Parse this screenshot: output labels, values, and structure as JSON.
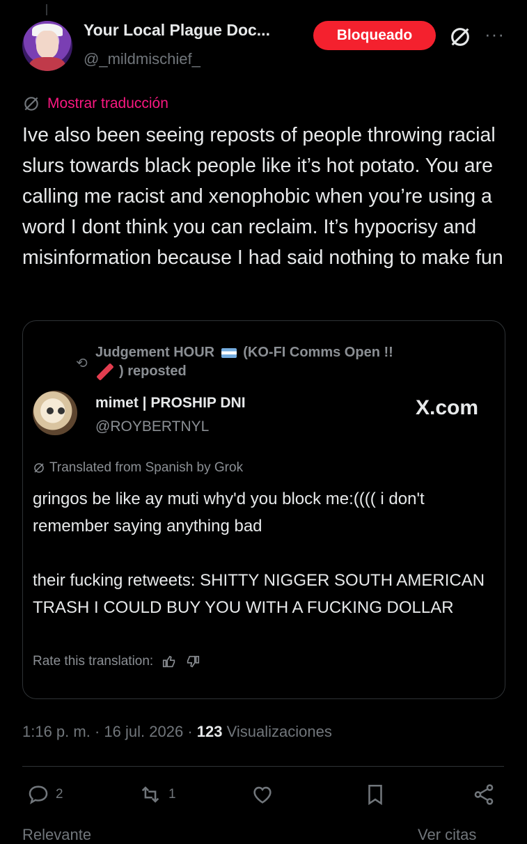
{
  "author": {
    "display_name": "Your Local Plague Doc...",
    "handle": "@_mildmischief_"
  },
  "blocked_button": {
    "label": "Bloqueado"
  },
  "translate_link": "Mostrar traducción",
  "tweet_text": "Ive also been seeing reposts of people throwing racial slurs towards black people like it’s hot potato. You are calling me racist and xenophobic when you’re using a word I dont think you can reclaim. It’s hypocrisy and misinformation because I had said nothing to make fun",
  "quote": {
    "repost_name": "Judgement HOUR",
    "repost_rest": "(KO-FI Comms Open !!",
    "repost_suffix": ") reposted",
    "name": "mimet | PROSHIP DNI",
    "handle": "@ROYBERTNYL",
    "source_label": "X.com",
    "grok_note": "Translated from Spanish by Grok",
    "text": "gringos be like ay muti why'd you block me:(((( i don't remember saying anything bad\n\ntheir fucking retweets: SHITTY NIGGER SOUTH AMERICAN TRASH I COULD BUY YOU WITH A FUCKING DOLLAR",
    "rate_label": "Rate this translation:"
  },
  "meta": {
    "time": "1:16 p. m.",
    "date": "16 jul. 2026",
    "views_count": "123",
    "views_label": "Visualizaciones"
  },
  "actions": {
    "replies": "2",
    "reposts": "1"
  },
  "footer": {
    "left": "Relevante",
    "right": "Ver citas"
  },
  "colors": {
    "background": "#000000",
    "accent_pink": "#f91880",
    "blocked_red": "#f4212e",
    "muted": "#71767b"
  }
}
